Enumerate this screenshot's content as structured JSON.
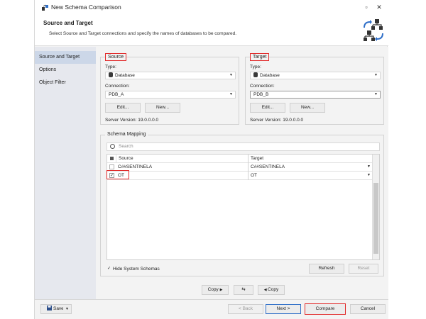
{
  "window": {
    "title": "New Schema Comparison"
  },
  "header": {
    "title": "Source and Target",
    "description": "Select Source and Target connections and specify the names of databases to be compared."
  },
  "nav": {
    "items": [
      {
        "label": "Source and Target",
        "active": true
      },
      {
        "label": "Options",
        "active": false
      },
      {
        "label": "Object Filter",
        "active": false
      }
    ]
  },
  "source": {
    "group_label": "Source",
    "type_label": "Type:",
    "type_value": "Database",
    "connection_label": "Connection:",
    "connection_value": "PDB_A",
    "edit_label": "Edit...",
    "new_label": "New...",
    "server_version": "Server Version: 19.0.0.0.0"
  },
  "target": {
    "group_label": "Target",
    "type_label": "Type:",
    "type_value": "Database",
    "connection_label": "Connection:",
    "connection_value": "PDB_B",
    "edit_label": "Edit...",
    "new_label": "New...",
    "server_version": "Server Version: 19.0.0.0.0"
  },
  "schema_mapping": {
    "group_label": "Schema Mapping",
    "search_placeholder": "Search",
    "columns": [
      "Source",
      "Target"
    ],
    "rows": [
      {
        "checked": false,
        "source": "C##SENTINELA",
        "target": "C##SENTINELA"
      },
      {
        "checked": true,
        "source": "OT",
        "target": "OT"
      }
    ],
    "hide_system_schemas_label": "Hide System Schemas",
    "hide_system_schemas_checked": true,
    "refresh_label": "Refresh",
    "reset_label": "Reset"
  },
  "copy_bar": {
    "copy_right_label": "Copy",
    "copy_left_label": "Copy"
  },
  "footer": {
    "save_label": "Save",
    "back_label": "< Back",
    "next_label": "Next >",
    "compare_label": "Compare",
    "cancel_label": "Cancel"
  },
  "colors": {
    "accent": "#2f6fc8",
    "highlight_border": "#e12a2a",
    "nav_active": "#ccd7e8"
  }
}
